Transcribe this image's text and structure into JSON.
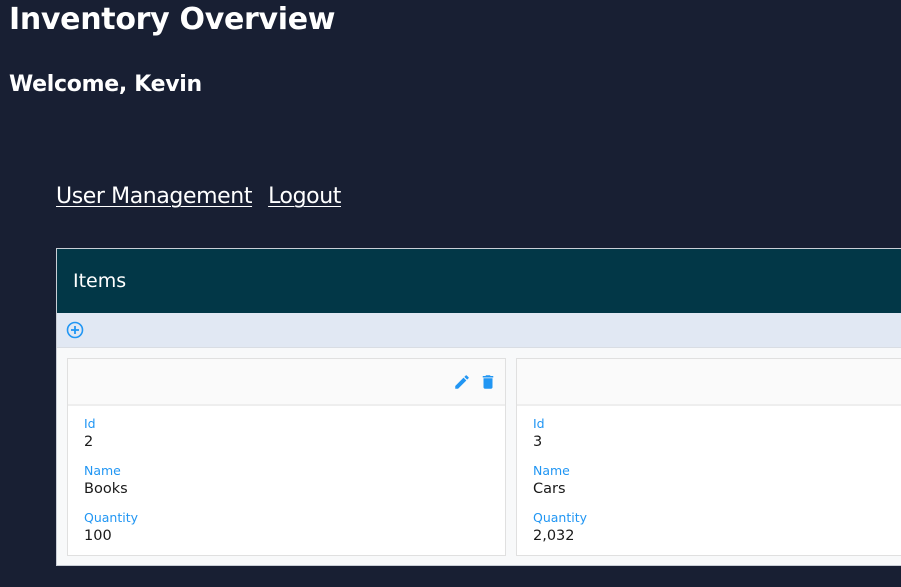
{
  "header": {
    "title": "Inventory Overview",
    "welcome": "Welcome, Kevin"
  },
  "nav": {
    "links": [
      {
        "label": "User Management"
      },
      {
        "label": "Logout"
      }
    ]
  },
  "panel": {
    "title": "Items",
    "toolbar": {
      "add_icon": "plus-circle-icon"
    },
    "cards": [
      {
        "actions": [
          "edit-icon",
          "delete-icon"
        ],
        "fields": [
          {
            "label": "Id",
            "value": "2"
          },
          {
            "label": "Name",
            "value": "Books"
          },
          {
            "label": "Quantity",
            "value": "100"
          }
        ]
      },
      {
        "actions": [],
        "fields": [
          {
            "label": "Id",
            "value": "3"
          },
          {
            "label": "Name",
            "value": "Cars"
          },
          {
            "label": "Quantity",
            "value": "2,032"
          }
        ]
      }
    ]
  },
  "colors": {
    "background": "#181f33",
    "panel_header": "#023747",
    "toolbar": "#e1e8f3",
    "accent": "#2196f3"
  }
}
